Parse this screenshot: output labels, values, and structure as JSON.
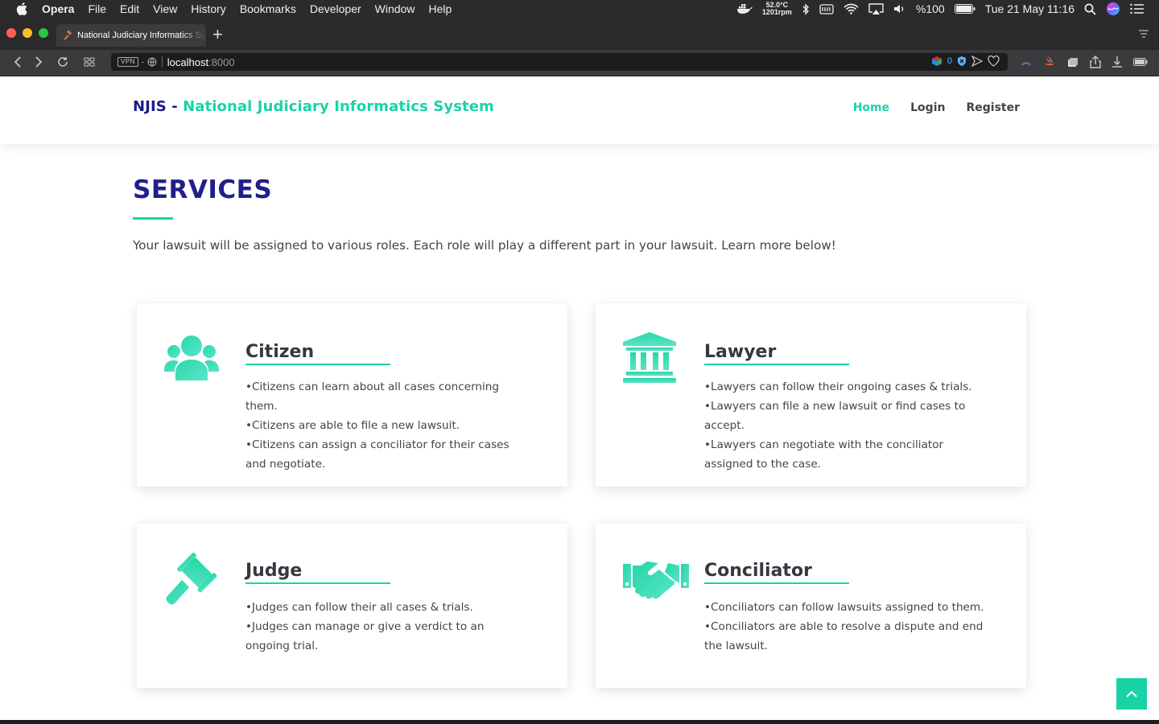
{
  "menubar": {
    "app": "Opera",
    "items": [
      "File",
      "Edit",
      "View",
      "History",
      "Bookmarks",
      "Developer",
      "Window",
      "Help"
    ],
    "temperature": "52.0°C",
    "fan_speed": "1201rpm",
    "battery": "%100",
    "datetime": "Tue 21 May  11:16"
  },
  "browser": {
    "tab_title": "National Judiciary Informatics System",
    "vpn_label": "VPN",
    "url_host": "localhost",
    "url_port": ":8000",
    "adblock_count": "0"
  },
  "site": {
    "logo_abbr": "NJIS - ",
    "logo_full": "National Judiciary Informatics System",
    "nav": {
      "home": "Home",
      "login": "Login",
      "register": "Register"
    }
  },
  "services": {
    "title": "SERVICES",
    "description": "Your lawsuit will be assigned to various roles. Each role will play a different part in your lawsuit. Learn more below!",
    "cards": [
      {
        "title": "Citizen",
        "icon": "users-icon",
        "items": [
          "Citizens can learn about all cases concerning them.",
          "Citizens are able to file a new lawsuit.",
          "Citizens can assign a conciliator for their cases and negotiate."
        ]
      },
      {
        "title": "Lawyer",
        "icon": "courthouse-icon",
        "items": [
          "Lawyers can follow their ongoing cases & trials.",
          "Lawyers can file a new lawsuit or find cases to accept.",
          "Lawyers can negotiate with the conciliator assigned to the case."
        ]
      },
      {
        "title": "Judge",
        "icon": "gavel-icon",
        "items": [
          "Judges can follow their all cases & trials.",
          "Judges can manage or give a verdict to an ongoing trial."
        ]
      },
      {
        "title": "Conciliator",
        "icon": "handshake-icon",
        "items": [
          "Conciliators can follow lawsuits assigned to them.",
          "Conciliators are able to resolve a dispute and end the lawsuit."
        ]
      }
    ]
  },
  "colors": {
    "brand_navy": "#1f1f8c",
    "accent_teal": "#19d3a6"
  }
}
